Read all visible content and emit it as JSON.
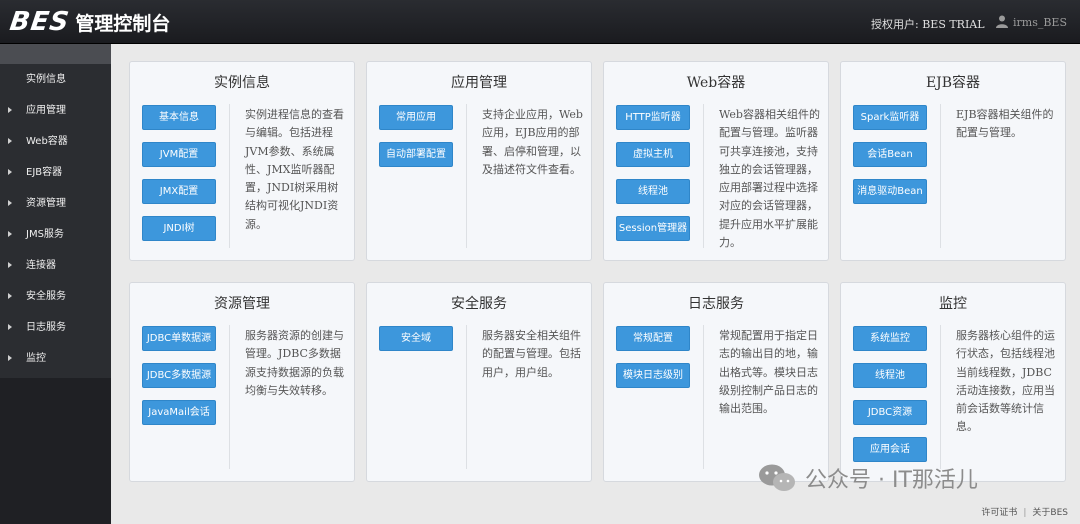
{
  "header": {
    "logo": "BES",
    "title": "管理控制台",
    "user_label": "授权用户: BES TRIAL",
    "user_name": "irms_BES"
  },
  "sidebar": {
    "items": [
      {
        "label": "实例信息",
        "arrow": false
      },
      {
        "label": "应用管理",
        "arrow": true
      },
      {
        "label": "Web容器",
        "arrow": true
      },
      {
        "label": "EJB容器",
        "arrow": true
      },
      {
        "label": "资源管理",
        "arrow": true
      },
      {
        "label": "JMS服务",
        "arrow": true
      },
      {
        "label": "连接器",
        "arrow": true
      },
      {
        "label": "安全服务",
        "arrow": true
      },
      {
        "label": "日志服务",
        "arrow": true
      },
      {
        "label": "监控",
        "arrow": true
      }
    ]
  },
  "cards": [
    {
      "title": "实例信息",
      "buttons": [
        "基本信息",
        "JVM配置",
        "JMX配置",
        "JNDI树"
      ],
      "desc": "实例进程信息的查看与编辑。包括进程JVM参数、系统属性、JMX监听器配置，JNDI树采用树结构可视化JNDI资源。"
    },
    {
      "title": "应用管理",
      "buttons": [
        "常用应用",
        "自动部署配置"
      ],
      "desc": "支持企业应用，Web应用，EJB应用的部署、启停和管理，以及描述符文件查看。"
    },
    {
      "title": "Web容器",
      "buttons": [
        "HTTP监听器",
        "虚拟主机",
        "线程池",
        "Session管理器"
      ],
      "desc": "Web容器相关组件的配置与管理。监听器可共享连接池，支持独立的会话管理器，应用部署过程中选择对应的会话管理器，提升应用水平扩展能力。"
    },
    {
      "title": "EJB容器",
      "buttons": [
        "Spark监听器",
        "会话Bean",
        "消息驱动Bean"
      ],
      "desc": "EJB容器相关组件的配置与管理。"
    },
    {
      "title": "资源管理",
      "buttons": [
        "JDBC单数据源",
        "JDBC多数据源",
        "JavaMail会话"
      ],
      "desc": "服务器资源的创建与管理。JDBC多数据源支持数据源的负载均衡与失效转移。"
    },
    {
      "title": "安全服务",
      "buttons": [
        "安全域"
      ],
      "desc": "服务器安全相关组件的配置与管理。包括用户，用户组。"
    },
    {
      "title": "日志服务",
      "buttons": [
        "常规配置",
        "模块日志级别"
      ],
      "desc": "常规配置用于指定日志的输出目的地，输出格式等。模块日志级别控制产品日志的输出范围。"
    },
    {
      "title": "监控",
      "buttons": [
        "系统监控",
        "线程池",
        "JDBC资源",
        "应用会话"
      ],
      "desc": "服务器核心组件的运行状态，包括线程池当前线程数，JDBC活动连接数，应用当前会话数等统计信息。"
    }
  ],
  "footer": {
    "license": "许可证书",
    "about": "关于BES"
  },
  "watermark": "公众号 · IT那活儿",
  "colors": {
    "accent": "#3d97dc",
    "header": "#1f2024",
    "sidebar": "#2b2d31"
  }
}
